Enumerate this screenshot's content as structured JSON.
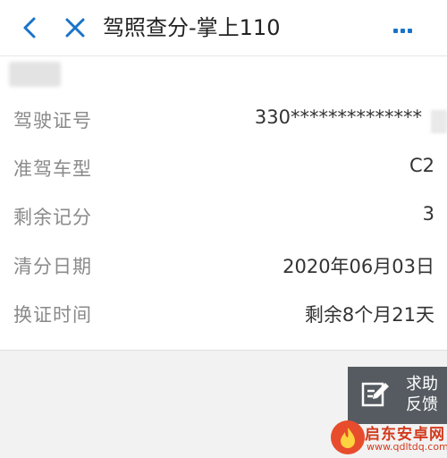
{
  "header": {
    "title": "驾照查分-掌上110",
    "back_icon": "back-chevron-icon",
    "close_icon": "close-x-icon",
    "more_icon": "more-dots-icon"
  },
  "colors": {
    "accent": "#1a73c8",
    "label": "#8a8a8a",
    "value": "#333333",
    "help_bg": "#555b61"
  },
  "info": {
    "rows": [
      {
        "label": "驾驶证号",
        "value": "330**************"
      },
      {
        "label": "准驾车型",
        "value": "C2"
      },
      {
        "label": "剩余记分",
        "value": "3"
      },
      {
        "label": "清分日期",
        "value": "2020年06月03日"
      },
      {
        "label": "换证时间",
        "value": "剩余8个月21天"
      }
    ]
  },
  "help": {
    "line1": "求助",
    "line2": "反馈",
    "icon": "edit-feedback-icon"
  },
  "watermark": {
    "title": "启东安卓网",
    "url": "www.qdltdq.com"
  }
}
